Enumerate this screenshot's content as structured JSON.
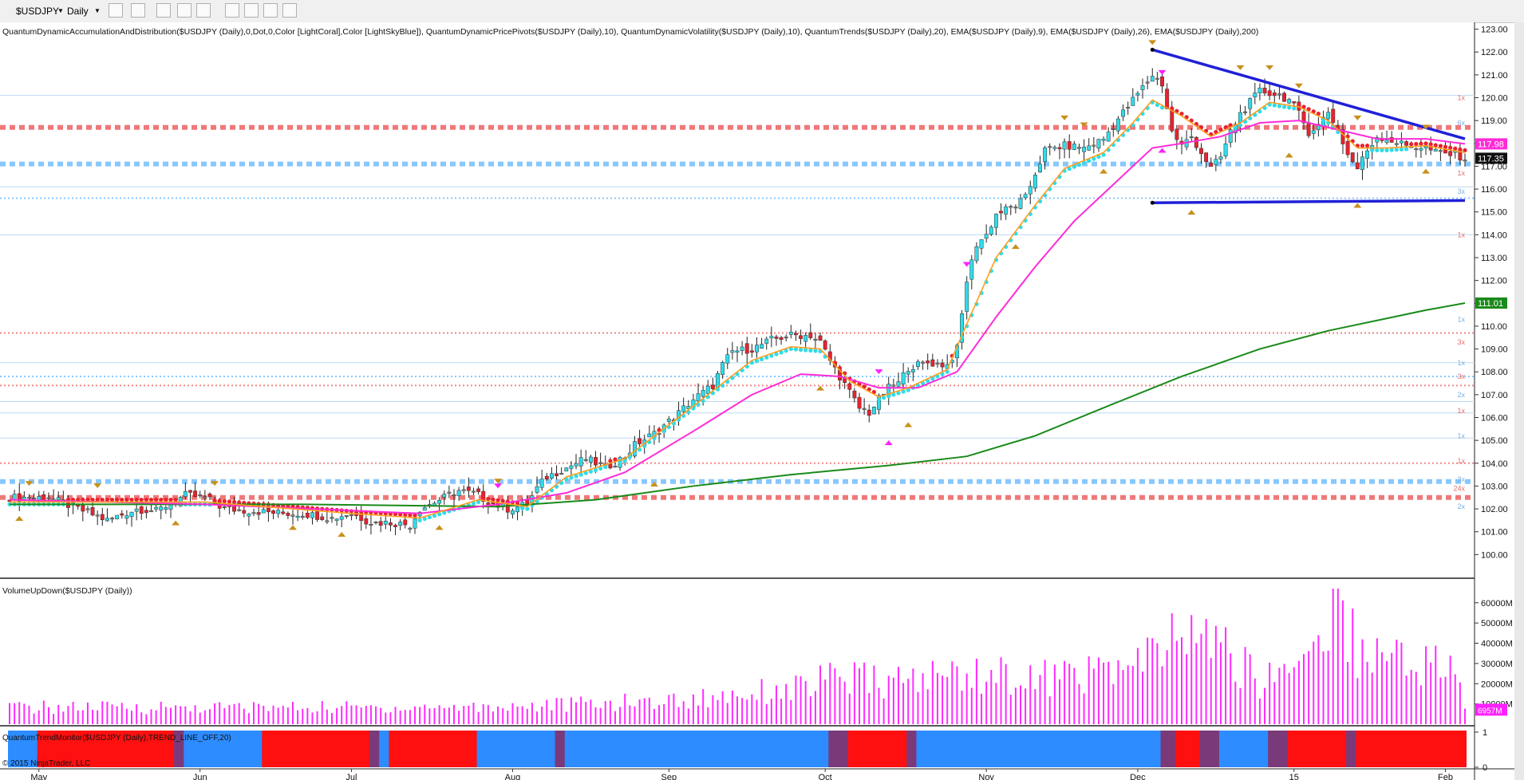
{
  "toolbar": {
    "symbol": "$USDJPY",
    "interval": "Daily",
    "icons": [
      "bar-type-icon",
      "draw-pencil-icon",
      "crosshair-icon",
      "pointer-icon",
      "zoom-icon",
      "data-box-icon",
      "chart-style-icon",
      "properties-icon",
      "strategy-icon"
    ]
  },
  "colors": {
    "up_candle": "#2fdcea",
    "down_candle": "#e8222e",
    "neutral_candle": "#8a8a8a",
    "ema9": "#ff9f1c",
    "ema26": "#ff2bd8",
    "ema200": "#1a8a1a",
    "trendline": "#2020d8",
    "volume": "#ff2bff",
    "trend_up": "#2d8cff",
    "trend_down": "#ff1010",
    "trend_mixed": "#7a3a7a",
    "pivot_marker": "#c8901a"
  },
  "chart_data": {
    "type": "candlestick",
    "price_panel": {
      "indicator_label": "QuantumDynamicAccumulationAndDistribution($USDJPY (Daily),0,Dot,0,Color [LightCoral],Color [LightSkyBlue]), QuantumDynamicPricePivots($USDJPY (Daily),10), QuantumDynamicVolatility($USDJPY (Daily),10), QuantumTrends($USDJPY (Daily),20), EMA($USDJPY (Daily),9), EMA($USDJPY (Daily),26), EMA($USDJPY (Daily),200)",
      "yticks": [
        "123.00",
        "122.00",
        "121.00",
        "120.00",
        "119.00",
        "118.00",
        "117.00",
        "116.00",
        "115.00",
        "114.00",
        "113.00",
        "112.00",
        "111.00",
        "110.00",
        "109.00",
        "108.00",
        "107.00",
        "106.00",
        "105.00",
        "104.00",
        "103.00",
        "102.00",
        "101.00",
        "100.00"
      ],
      "ylim": [
        99.0,
        123.3
      ],
      "last_price_labels": [
        "117.98",
        "117.35",
        "111.01"
      ],
      "resistance_levels": [
        118.7,
        109.7,
        107.4,
        104.0,
        102.5
      ],
      "support_levels": [
        117.1,
        115.6,
        107.8,
        103.2
      ],
      "minor_levels": [
        120.1,
        116.1,
        114.0,
        108.4,
        106.7,
        106.2,
        105.1
      ],
      "level_counts": [
        "1x",
        "6x",
        "1x",
        "3x",
        "1x",
        "1x",
        "3x",
        "1x",
        "3x",
        "2x",
        "1x",
        "1x",
        "1x",
        "3x",
        "24x",
        "2x"
      ],
      "close_path": [
        [
          0,
          102.5
        ],
        [
          8,
          102.5
        ],
        [
          14,
          102.0
        ],
        [
          20,
          101.5
        ],
        [
          26,
          102.0
        ],
        [
          30,
          101.9
        ],
        [
          36,
          102.6
        ],
        [
          40,
          102.5
        ],
        [
          44,
          102.0
        ],
        [
          50,
          101.9
        ],
        [
          56,
          101.8
        ],
        [
          60,
          101.8
        ],
        [
          66,
          101.6
        ],
        [
          70,
          101.8
        ],
        [
          74,
          101.4
        ],
        [
          78,
          101.4
        ],
        [
          82,
          101.3
        ],
        [
          84,
          102.0
        ],
        [
          88,
          102.4
        ],
        [
          92,
          102.8
        ],
        [
          96,
          102.6
        ],
        [
          98,
          102.3
        ],
        [
          102,
          102.0
        ],
        [
          106,
          102.2
        ],
        [
          108,
          102.9
        ],
        [
          110,
          103.4
        ],
        [
          114,
          103.8
        ],
        [
          118,
          104.2
        ],
        [
          122,
          103.8
        ],
        [
          126,
          104.3
        ],
        [
          128,
          104.8
        ],
        [
          132,
          105.3
        ],
        [
          136,
          106.0
        ],
        [
          140,
          106.8
        ],
        [
          144,
          107.4
        ],
        [
          146,
          108.3
        ],
        [
          148,
          108.9
        ],
        [
          152,
          109.0
        ],
        [
          156,
          109.4
        ],
        [
          160,
          109.6
        ],
        [
          164,
          109.6
        ],
        [
          166,
          109.3
        ],
        [
          168,
          108.5
        ],
        [
          170,
          107.8
        ],
        [
          172,
          107.1
        ],
        [
          174,
          106.4
        ],
        [
          176,
          106.2
        ],
        [
          178,
          106.8
        ],
        [
          180,
          107.3
        ],
        [
          182,
          107.5
        ],
        [
          184,
          108.2
        ],
        [
          188,
          108.4
        ],
        [
          192,
          108.3
        ],
        [
          194,
          109.0
        ],
        [
          196,
          112.0
        ],
        [
          198,
          113.6
        ],
        [
          200,
          114.0
        ],
        [
          202,
          114.9
        ],
        [
          206,
          115.3
        ],
        [
          208,
          115.6
        ],
        [
          210,
          116.7
        ],
        [
          212,
          117.7
        ],
        [
          216,
          117.9
        ],
        [
          220,
          117.8
        ],
        [
          224,
          118.2
        ],
        [
          226,
          118.8
        ],
        [
          230,
          119.9
        ],
        [
          234,
          121.0
        ],
        [
          236,
          120.6
        ],
        [
          238,
          118.5
        ],
        [
          240,
          117.9
        ],
        [
          242,
          118.3
        ],
        [
          244,
          117.6
        ],
        [
          246,
          116.9
        ],
        [
          248,
          117.4
        ],
        [
          250,
          118.5
        ],
        [
          252,
          119.3
        ],
        [
          256,
          120.3
        ],
        [
          260,
          120.1
        ],
        [
          262,
          119.9
        ],
        [
          264,
          119.3
        ],
        [
          266,
          118.5
        ],
        [
          268,
          118.8
        ],
        [
          270,
          119.4
        ],
        [
          272,
          118.6
        ],
        [
          274,
          117.5
        ],
        [
          276,
          116.9
        ],
        [
          278,
          117.7
        ],
        [
          280,
          118.3
        ],
        [
          282,
          118.2
        ],
        [
          286,
          117.9
        ],
        [
          290,
          117.8
        ],
        [
          292,
          117.6
        ],
        [
          296,
          117.5
        ],
        [
          298,
          117.35
        ]
      ],
      "ema9_path": [
        [
          0,
          102.3
        ],
        [
          40,
          102.3
        ],
        [
          70,
          101.8
        ],
        [
          84,
          101.6
        ],
        [
          96,
          102.4
        ],
        [
          106,
          102.1
        ],
        [
          114,
          103.4
        ],
        [
          126,
          104.2
        ],
        [
          140,
          106.5
        ],
        [
          152,
          108.5
        ],
        [
          160,
          109.1
        ],
        [
          166,
          109.0
        ],
        [
          172,
          107.6
        ],
        [
          178,
          106.9
        ],
        [
          184,
          107.3
        ],
        [
          192,
          108.1
        ],
        [
          196,
          110.1
        ],
        [
          202,
          113.0
        ],
        [
          210,
          115.3
        ],
        [
          216,
          116.9
        ],
        [
          224,
          117.6
        ],
        [
          230,
          118.9
        ],
        [
          234,
          119.9
        ],
        [
          240,
          119.2
        ],
        [
          246,
          118.3
        ],
        [
          252,
          118.9
        ],
        [
          258,
          119.8
        ],
        [
          264,
          119.6
        ],
        [
          270,
          119.0
        ],
        [
          276,
          117.8
        ],
        [
          282,
          117.8
        ],
        [
          290,
          117.9
        ],
        [
          298,
          117.6
        ]
      ],
      "ema26_path": [
        [
          0,
          102.4
        ],
        [
          40,
          102.2
        ],
        [
          84,
          101.8
        ],
        [
          100,
          102.2
        ],
        [
          114,
          102.7
        ],
        [
          126,
          103.6
        ],
        [
          140,
          105.4
        ],
        [
          152,
          107.0
        ],
        [
          162,
          107.9
        ],
        [
          170,
          107.8
        ],
        [
          178,
          107.3
        ],
        [
          186,
          107.3
        ],
        [
          194,
          108.0
        ],
        [
          202,
          110.4
        ],
        [
          210,
          112.6
        ],
        [
          218,
          114.6
        ],
        [
          226,
          116.2
        ],
        [
          234,
          117.8
        ],
        [
          240,
          118.0
        ],
        [
          248,
          118.3
        ],
        [
          256,
          118.9
        ],
        [
          264,
          119.0
        ],
        [
          272,
          118.6
        ],
        [
          280,
          118.2
        ],
        [
          290,
          118.2
        ],
        [
          298,
          117.98
        ]
      ],
      "ema200_path": [
        [
          0,
          102.2
        ],
        [
          60,
          102.2
        ],
        [
          100,
          102.1
        ],
        [
          120,
          102.4
        ],
        [
          140,
          103.0
        ],
        [
          160,
          103.5
        ],
        [
          180,
          103.9
        ],
        [
          196,
          104.3
        ],
        [
          210,
          105.2
        ],
        [
          226,
          106.6
        ],
        [
          240,
          107.8
        ],
        [
          256,
          109.0
        ],
        [
          270,
          109.8
        ],
        [
          290,
          110.7
        ],
        [
          298,
          111.01
        ]
      ],
      "trendlines": [
        {
          "from": [
            234,
            122.1
          ],
          "to": [
            298,
            118.2
          ]
        },
        {
          "from": [
            234,
            115.4
          ],
          "to": [
            298,
            115.5
          ]
        }
      ],
      "pivot_highs": [
        [
          4,
          102.8
        ],
        [
          18,
          102.7
        ],
        [
          42,
          102.8
        ],
        [
          100,
          102.9
        ],
        [
          216,
          118.8
        ],
        [
          220,
          118.5
        ],
        [
          234,
          122.1
        ],
        [
          252,
          121.0
        ],
        [
          258,
          121.0
        ],
        [
          264,
          120.2
        ],
        [
          276,
          118.8
        ],
        [
          290,
          118.4
        ]
      ],
      "pivot_lows": [
        [
          2,
          101.9
        ],
        [
          34,
          101.7
        ],
        [
          58,
          101.5
        ],
        [
          68,
          101.2
        ],
        [
          88,
          101.5
        ],
        [
          132,
          103.4
        ],
        [
          166,
          107.6
        ],
        [
          184,
          106.0
        ],
        [
          206,
          113.8
        ],
        [
          224,
          117.1
        ],
        [
          242,
          115.3
        ],
        [
          262,
          117.8
        ],
        [
          276,
          115.6
        ],
        [
          290,
          117.1
        ]
      ],
      "magenta_markers_up": [
        [
          100,
          102.9
        ],
        [
          178,
          107.9
        ],
        [
          196,
          112.6
        ],
        [
          236,
          121.0
        ]
      ],
      "magenta_markers_down": [
        [
          180,
          105.0
        ],
        [
          236,
          117.8
        ]
      ]
    },
    "volume_panel": {
      "label": "VolumeUpDown($USDJPY (Daily))",
      "yticks": [
        "60000M",
        "50000M",
        "40000M",
        "30000M",
        "20000M",
        "10000M"
      ],
      "ylim": [
        0,
        67000
      ],
      "last_label": "6957M",
      "profile": [
        [
          0,
          9000
        ],
        [
          40,
          9000
        ],
        [
          80,
          9000
        ],
        [
          100,
          9500
        ],
        [
          120,
          11000
        ],
        [
          140,
          13000
        ],
        [
          150,
          17000
        ],
        [
          160,
          19000
        ],
        [
          170,
          25000
        ],
        [
          180,
          22000
        ],
        [
          196,
          28000
        ],
        [
          210,
          24000
        ],
        [
          220,
          27000
        ],
        [
          232,
          32000
        ],
        [
          238,
          44000
        ],
        [
          242,
          48000
        ],
        [
          248,
          42000
        ],
        [
          256,
          22000
        ],
        [
          262,
          32000
        ],
        [
          268,
          44000
        ],
        [
          272,
          67000
        ],
        [
          276,
          40000
        ],
        [
          282,
          38000
        ],
        [
          290,
          33000
        ],
        [
          296,
          30000
        ],
        [
          298,
          7000
        ]
      ]
    },
    "trend_panel": {
      "label": "QuantumTrendMonitor($USDJPY (Daily),TREND_LINE_OFF,20)",
      "yticks": [
        "1",
        "0"
      ],
      "segments": [
        {
          "from": 0,
          "to": 6,
          "state": "up"
        },
        {
          "from": 6,
          "to": 34,
          "state": "down"
        },
        {
          "from": 34,
          "to": 36,
          "state": "mixed"
        },
        {
          "from": 36,
          "to": 52,
          "state": "up"
        },
        {
          "from": 52,
          "to": 74,
          "state": "down"
        },
        {
          "from": 74,
          "to": 76,
          "state": "mixed"
        },
        {
          "from": 76,
          "to": 78,
          "state": "up"
        },
        {
          "from": 78,
          "to": 96,
          "state": "down"
        },
        {
          "from": 96,
          "to": 112,
          "state": "up"
        },
        {
          "from": 112,
          "to": 114,
          "state": "mixed"
        },
        {
          "from": 114,
          "to": 168,
          "state": "up"
        },
        {
          "from": 168,
          "to": 172,
          "state": "mixed"
        },
        {
          "from": 172,
          "to": 184,
          "state": "down"
        },
        {
          "from": 184,
          "to": 186,
          "state": "mixed"
        },
        {
          "from": 186,
          "to": 236,
          "state": "up"
        },
        {
          "from": 236,
          "to": 239,
          "state": "mixed"
        },
        {
          "from": 239,
          "to": 244,
          "state": "down"
        },
        {
          "from": 244,
          "to": 248,
          "state": "mixed"
        },
        {
          "from": 248,
          "to": 258,
          "state": "up"
        },
        {
          "from": 258,
          "to": 262,
          "state": "mixed"
        },
        {
          "from": 262,
          "to": 274,
          "state": "down"
        },
        {
          "from": 274,
          "to": 276,
          "state": "mixed"
        },
        {
          "from": 276,
          "to": 298,
          "state": "down"
        }
      ]
    },
    "x_labels": [
      {
        "label": "May",
        "index": 6
      },
      {
        "label": "Jun",
        "index": 39
      },
      {
        "label": "Jul",
        "index": 70
      },
      {
        "label": "Aug",
        "index": 103
      },
      {
        "label": "Sep",
        "index": 135
      },
      {
        "label": "Oct",
        "index": 167
      },
      {
        "label": "Nov",
        "index": 200
      },
      {
        "label": "Dec",
        "index": 231
      },
      {
        "label": "15",
        "index": 263
      },
      {
        "label": "Feb",
        "index": 294
      }
    ],
    "copyright": "© 2015 NinjaTrader, LLC"
  }
}
